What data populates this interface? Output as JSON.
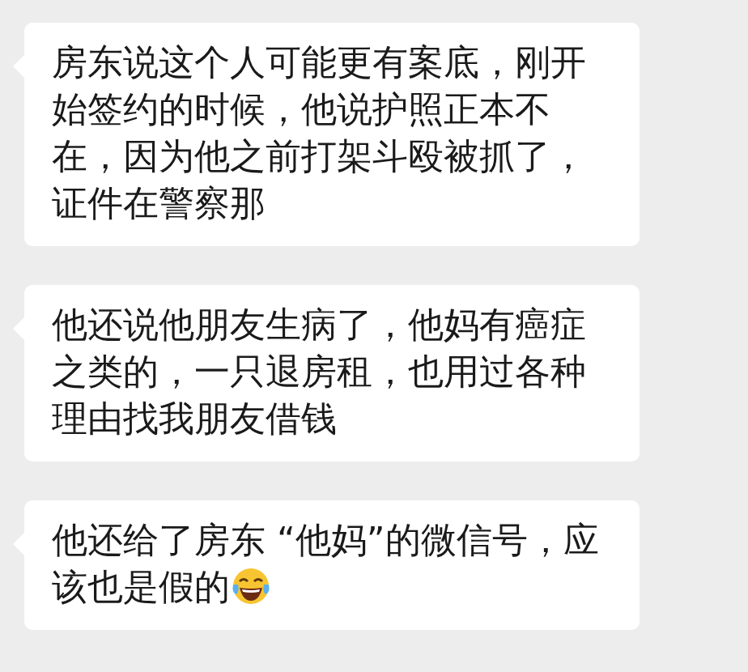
{
  "messages": [
    {
      "text": "房东说这个人可能更有案底，刚开始签约的时候，他说护照正本不在，因为他之前打架斗殴被抓了，证件在警察那",
      "has_emoji": false
    },
    {
      "text": "他还说他朋友生病了，他妈有癌症之类的，一只退房租，也用过各种理由找我朋友借钱",
      "has_emoji": false
    },
    {
      "text": "他还给了房东 “他妈”的微信号，应该也是假的",
      "has_emoji": true
    }
  ]
}
